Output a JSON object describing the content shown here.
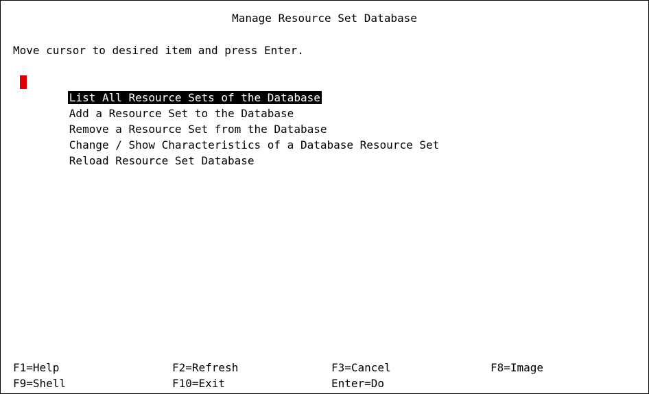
{
  "screen": {
    "title": "Manage Resource Set Database",
    "instruction": "Move cursor to desired item and press Enter."
  },
  "menu": {
    "selected_index": 0,
    "items": [
      {
        "label": "List All Resource Sets of the Database"
      },
      {
        "label": "Add a Resource Set to the Database"
      },
      {
        "label": "Remove a Resource Set from the Database"
      },
      {
        "label": "Change / Show Characteristics of a Database Resource Set"
      },
      {
        "label": "Reload Resource Set Database"
      }
    ]
  },
  "function_keys": {
    "row1": [
      {
        "label": "F1=Help"
      },
      {
        "label": "F2=Refresh"
      },
      {
        "label": "F3=Cancel"
      },
      {
        "label": "F8=Image"
      }
    ],
    "row2": [
      {
        "label": "F9=Shell"
      },
      {
        "label": "F10=Exit"
      },
      {
        "label": "Enter=Do"
      }
    ]
  },
  "colors": {
    "background": "#ffffff",
    "text": "#000000",
    "selection_background": "#000000",
    "selection_text": "#ffffff",
    "cursor": "#e00000"
  }
}
